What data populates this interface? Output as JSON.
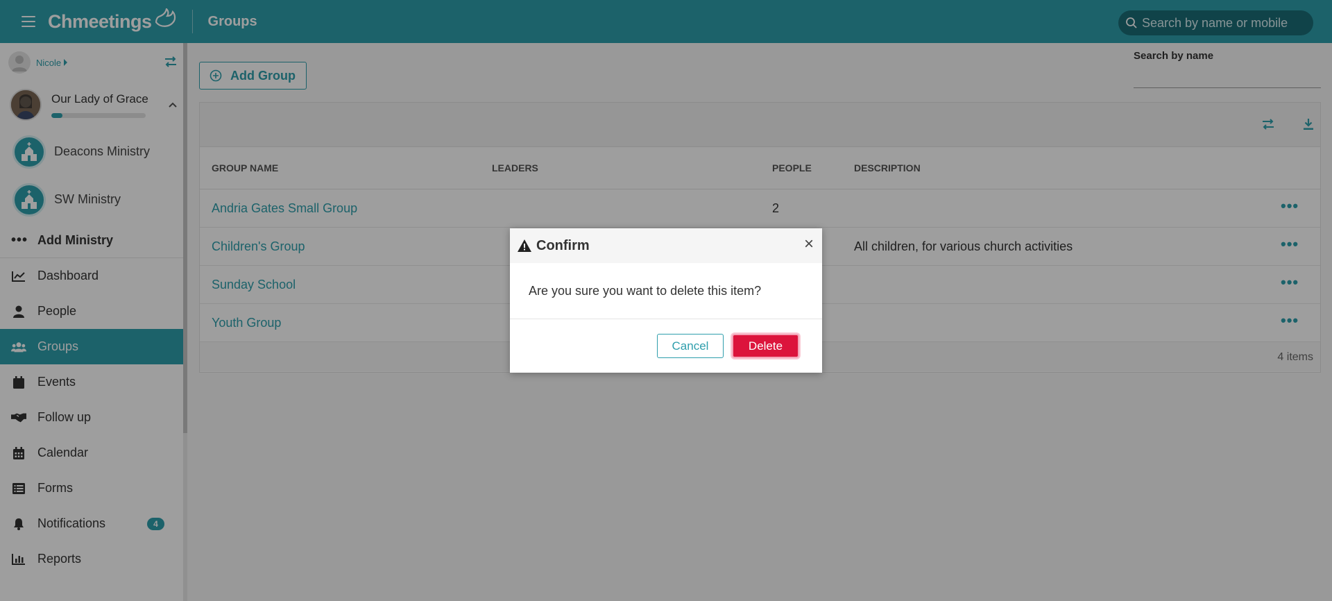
{
  "topbar": {
    "brand": "Chmeetings",
    "page_title": "Groups",
    "search_placeholder": "Search by name or mobile"
  },
  "sidebar": {
    "user_name": "Nicole",
    "org": {
      "name": "Our Lady of Grace",
      "progress": 0.12
    },
    "ministries": [
      {
        "label": "Deacons Ministry"
      },
      {
        "label": "SW Ministry"
      }
    ],
    "add_ministry_label": "Add Ministry",
    "nav": [
      {
        "label": "Dashboard",
        "icon": "chart-line-icon"
      },
      {
        "label": "People",
        "icon": "user-icon"
      },
      {
        "label": "Groups",
        "icon": "users-icon",
        "active": true
      },
      {
        "label": "Events",
        "icon": "calendar-icon"
      },
      {
        "label": "Follow up",
        "icon": "handshake-icon"
      },
      {
        "label": "Calendar",
        "icon": "calendar-grid-icon"
      },
      {
        "label": "Forms",
        "icon": "list-icon"
      },
      {
        "label": "Notifications",
        "icon": "bell-icon",
        "badge": "4"
      },
      {
        "label": "Reports",
        "icon": "bar-chart-icon"
      }
    ]
  },
  "main": {
    "add_group_label": "Add Group",
    "search_name_label": "Search by name",
    "columns": {
      "name": "GROUP NAME",
      "leaders": "LEADERS",
      "people": "PEOPLE",
      "description": "DESCRIPTION"
    },
    "rows": [
      {
        "name": "Andria Gates Small Group",
        "leaders": "",
        "people": "2",
        "description": ""
      },
      {
        "name": "Children's Group",
        "leaders": "",
        "people": "",
        "description": "All children, for various church activities"
      },
      {
        "name": "Sunday School",
        "leaders": "",
        "people": "",
        "description": ""
      },
      {
        "name": "Youth Group",
        "leaders": "",
        "people": "",
        "description": ""
      }
    ],
    "row_menu": "•••",
    "item_count": "4 items"
  },
  "modal": {
    "title": "Confirm",
    "close": "×",
    "message": "Are you sure you want to delete this item?",
    "cancel_label": "Cancel",
    "delete_label": "Delete"
  },
  "colors": {
    "primary": "#2e9eac",
    "danger": "#dc143c"
  }
}
